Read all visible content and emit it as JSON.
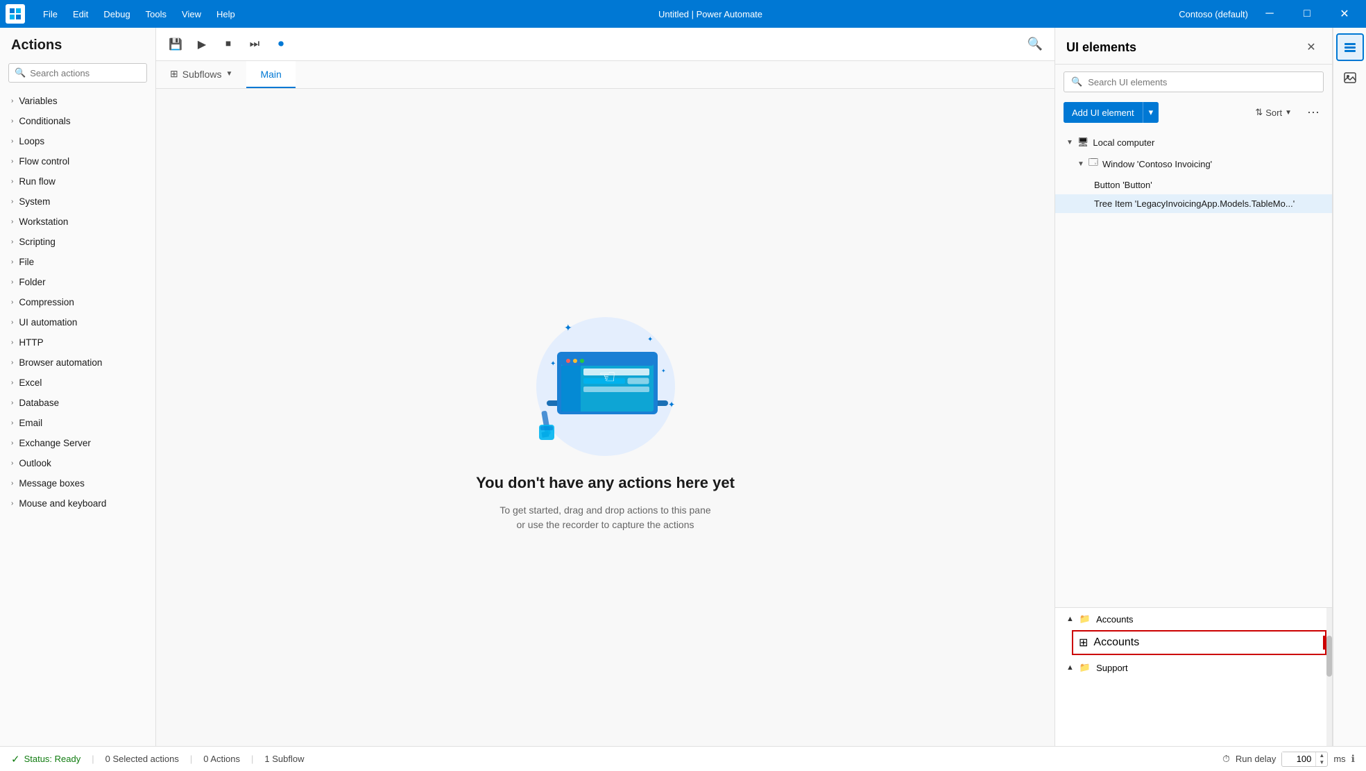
{
  "titlebar": {
    "menu_items": [
      "File",
      "Edit",
      "Debug",
      "Tools",
      "View",
      "Help"
    ],
    "title": "Untitled | Power Automate",
    "user": "Contoso (default)",
    "min_btn": "─",
    "max_btn": "□",
    "close_btn": "✕"
  },
  "actions_panel": {
    "title": "Actions",
    "search_placeholder": "Search actions",
    "items": [
      "Variables",
      "Conditionals",
      "Loops",
      "Flow control",
      "Run flow",
      "System",
      "Workstation",
      "Scripting",
      "File",
      "Folder",
      "Compression",
      "UI automation",
      "HTTP",
      "Browser automation",
      "Excel",
      "Database",
      "Email",
      "Exchange Server",
      "Outlook",
      "Message boxes",
      "Mouse and keyboard"
    ]
  },
  "canvas": {
    "tab_subflows": "Subflows",
    "tab_main": "Main",
    "empty_title": "You don't have any actions here yet",
    "empty_sub_line1": "To get started, drag and drop actions to this pane",
    "empty_sub_line2": "or use the recorder to capture the actions"
  },
  "ui_elements": {
    "title": "UI elements",
    "search_placeholder": "Search UI elements",
    "add_btn_label": "Add UI element",
    "sort_label": "Sort",
    "tree": [
      {
        "level": 0,
        "label": "Local computer",
        "icon": "💻",
        "expanded": true,
        "chevron": "▼"
      },
      {
        "level": 1,
        "label": "Window 'Contoso Invoicing'",
        "icon": "🪟",
        "expanded": true,
        "chevron": "▼"
      },
      {
        "level": 2,
        "label": "Button 'Button'",
        "icon": ""
      },
      {
        "level": 2,
        "label": "Tree Item 'LegacyInvoicingApp.Models.TableMo...'",
        "icon": "",
        "selected": true
      }
    ]
  },
  "bottom_tree": {
    "accounts_folder": "Accounts",
    "accounts_item": "Accounts",
    "support_folder": "Support"
  },
  "status_bar": {
    "status_text": "Status: Ready",
    "selected_actions": "0 Selected actions",
    "actions_count": "0 Actions",
    "subflow_count": "1 Subflow",
    "run_delay_label": "Run delay",
    "run_delay_value": "100",
    "run_delay_unit": "ms"
  },
  "rail_icons": {
    "layers_icon": "⧉",
    "image_icon": "🖼"
  }
}
